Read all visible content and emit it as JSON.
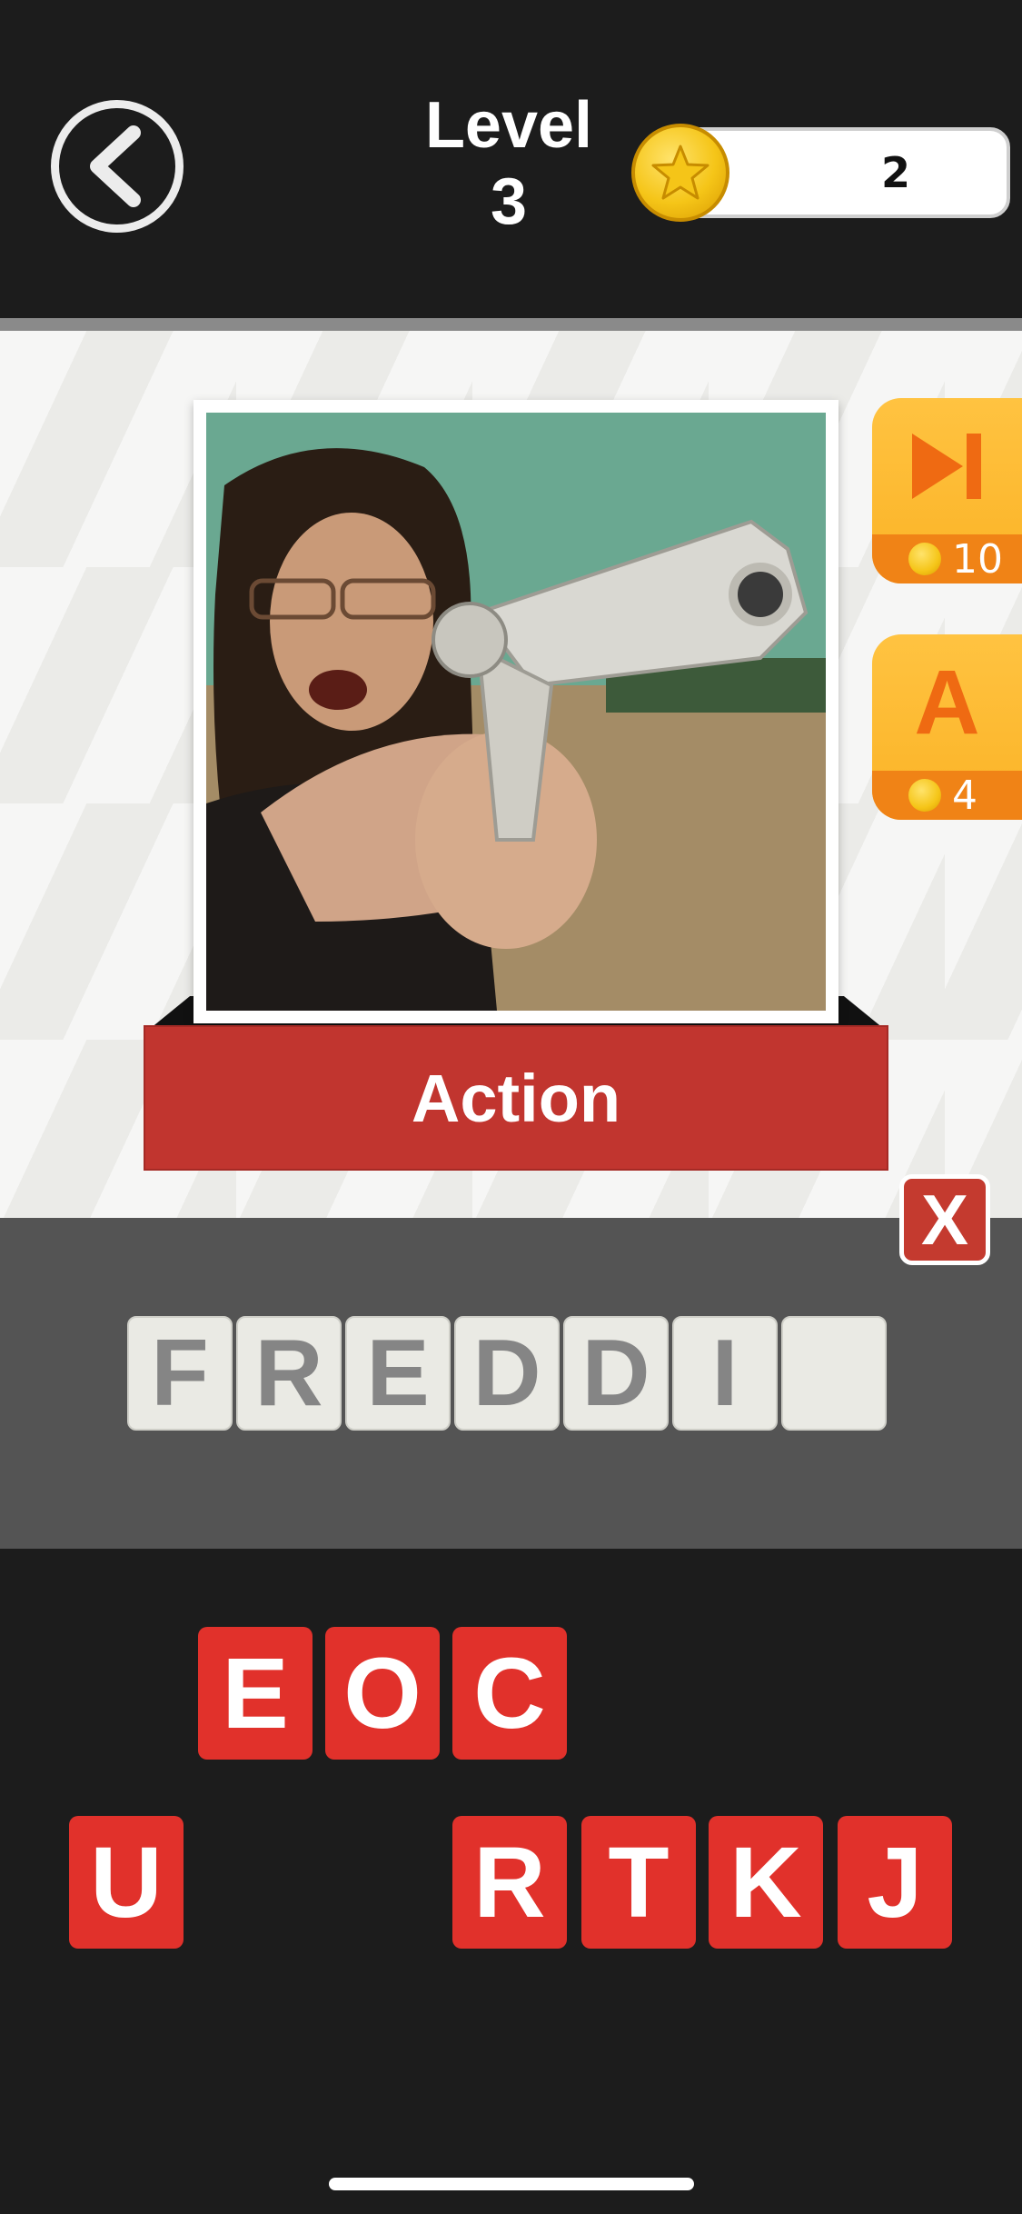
{
  "header": {
    "level_label": "Level",
    "level_number": "3",
    "coins": "2",
    "back_icon": "chevron-left-icon",
    "coin_icon": "star-coin-icon"
  },
  "puzzle": {
    "category": "Action",
    "photo_icon": "man-with-revolver-photo"
  },
  "powerups": [
    {
      "name": "skip",
      "icon": "skip-forward-icon",
      "cost": "10"
    },
    {
      "name": "reveal-letter",
      "icon": "letter-a-icon",
      "label": "A",
      "cost": "4"
    }
  ],
  "answer": {
    "slots": [
      "F",
      "R",
      "E",
      "D",
      "D",
      "I",
      ""
    ],
    "clear_label": "X"
  },
  "letters": {
    "row1": [
      "E",
      "O",
      "C"
    ],
    "row2": [
      "U",
      "R",
      "T",
      "K",
      "J"
    ]
  },
  "colors": {
    "background": "#1c1c1c",
    "banner": "#c1352f",
    "key": "#e1312b",
    "powerup": "#fbb326",
    "powerup_accent": "#ef6a12",
    "slot": "#eaeae4",
    "answer_panel": "#545454"
  }
}
